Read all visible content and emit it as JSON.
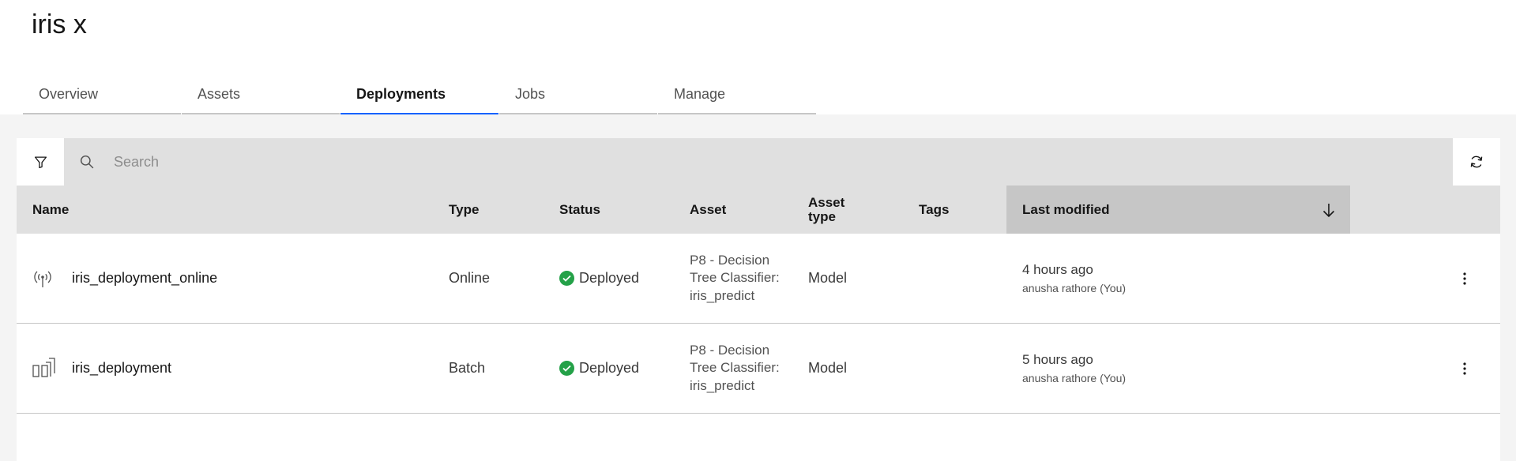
{
  "project": {
    "title": "iris x"
  },
  "tabs": [
    {
      "label": "Overview",
      "active": false
    },
    {
      "label": "Assets",
      "active": false
    },
    {
      "label": "Deployments",
      "active": true
    },
    {
      "label": "Jobs",
      "active": false
    },
    {
      "label": "Manage",
      "active": false
    }
  ],
  "toolbar": {
    "filter_icon": "filter-icon",
    "search_icon": "search-icon",
    "search_placeholder": "Search",
    "search_value": "",
    "refresh_icon": "refresh-icon"
  },
  "table": {
    "columns": {
      "name": "Name",
      "type": "Type",
      "status": "Status",
      "asset": "Asset",
      "asset_type": "Asset type",
      "tags": "Tags",
      "last_modified": "Last modified"
    },
    "sort": {
      "column": "last_modified",
      "direction": "descending",
      "icon": "arrow-down-icon"
    },
    "rows": [
      {
        "icon": "online-deployment-icon",
        "name": "iris_deployment_online",
        "type": "Online",
        "status": "Deployed",
        "asset": "P8 - Decision Tree Classifier: iris_predict",
        "asset_type": "Model",
        "tags": "",
        "modified_when": "4 hours ago",
        "modified_by": "anusha rathore (You)"
      },
      {
        "icon": "batch-deployment-icon",
        "name": "iris_deployment",
        "type": "Batch",
        "status": "Deployed",
        "asset": "P8 - Decision Tree Classifier: iris_predict",
        "asset_type": "Model",
        "tags": "",
        "modified_when": "5 hours ago",
        "modified_by": "anusha rathore (You)"
      }
    ]
  },
  "colors": {
    "accent": "#0f62fe",
    "success": "#24a148",
    "header_bg": "#e0e0e0",
    "sorted_header_bg": "#c6c6c6",
    "page_bg": "#f4f4f4"
  }
}
